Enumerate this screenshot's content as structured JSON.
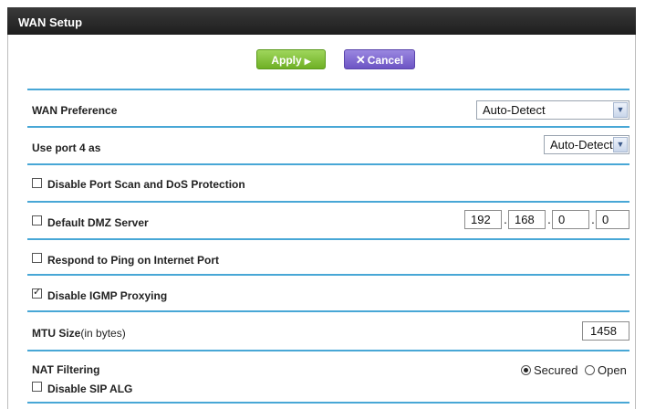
{
  "title": "WAN Setup",
  "buttons": {
    "apply": "Apply",
    "cancel": "Cancel"
  },
  "wan_preference": {
    "label": "WAN Preference",
    "value": "Auto-Detect"
  },
  "port4": {
    "label": "Use port 4 as",
    "value": "Auto-Detect"
  },
  "port_scan": {
    "label": "Disable Port Scan and DoS Protection",
    "checked": false
  },
  "dmz": {
    "label": "Default DMZ Server",
    "checked": false,
    "ip": [
      "192",
      "168",
      "0",
      "0"
    ]
  },
  "ping": {
    "label": "Respond to Ping on Internet Port",
    "checked": false
  },
  "igmp": {
    "label": "Disable IGMP Proxying",
    "checked": true
  },
  "mtu": {
    "label": "MTU Size",
    "unit": "(in bytes)",
    "value": "1458"
  },
  "nat": {
    "label": "NAT Filtering",
    "options": [
      "Secured",
      "Open"
    ],
    "selected": "Secured"
  },
  "sip": {
    "label": "Disable SIP ALG",
    "checked": false
  }
}
